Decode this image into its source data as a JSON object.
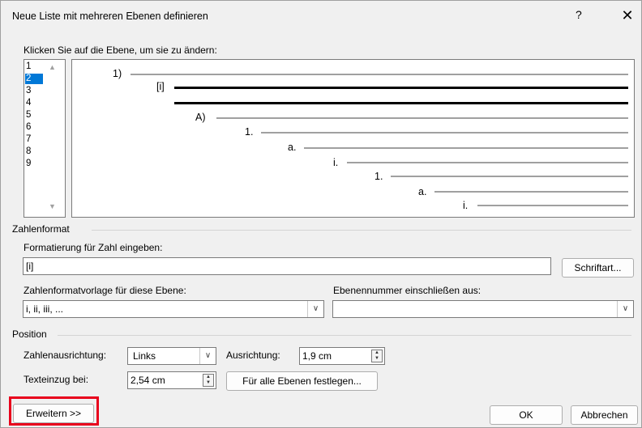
{
  "dialog": {
    "title": "Neue Liste mit mehreren Ebenen definieren",
    "help": "?",
    "close": "✕"
  },
  "level_select": {
    "label": "Klicken Sie auf die Ebene, um sie zu ändern:",
    "levels": [
      "1",
      "2",
      "3",
      "4",
      "5",
      "6",
      "7",
      "8",
      "9"
    ],
    "selected_index": 1
  },
  "preview": {
    "numbers": [
      "1)",
      "[i]",
      "A)",
      "1.",
      "a.",
      "i.",
      "1.",
      "a.",
      "i."
    ]
  },
  "number_format": {
    "section": "Zahlenformat",
    "enter_label": "Formatierung für Zahl eingeben:",
    "enter_value": "[i]",
    "font_button": "Schriftart...",
    "style_label": "Zahlenformatvorlage für diese Ebene:",
    "style_value": "i, ii, iii, ...",
    "include_label": "Ebenennummer einschließen aus:",
    "include_value": ""
  },
  "position": {
    "section": "Position",
    "alignment_label": "Zahlenausrichtung:",
    "alignment_value": "Links",
    "aligned_at_label": "Ausrichtung:",
    "aligned_at_value": "1,9 cm",
    "indent_label": "Texteinzug bei:",
    "indent_value": "2,54 cm",
    "set_all_button": "Für alle Ebenen festlegen..."
  },
  "footer": {
    "more_button": "Erweitern >>",
    "ok_button": "OK",
    "cancel_button": "Abbrechen"
  },
  "colors": {
    "selection": "#0078d7",
    "highlight_box": "#e8001c"
  }
}
